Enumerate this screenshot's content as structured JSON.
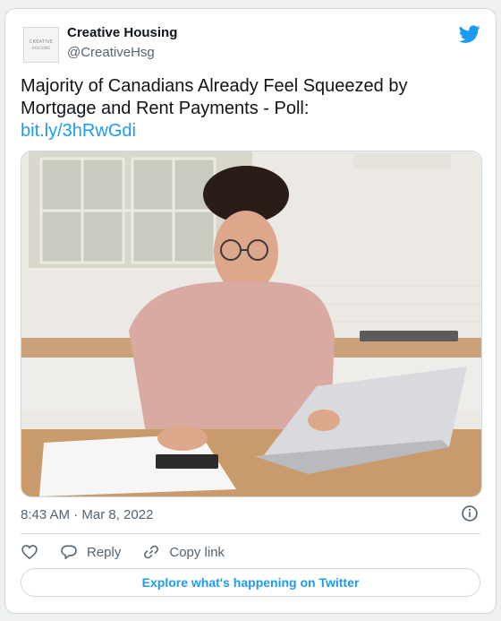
{
  "tweet": {
    "author": {
      "name": "Creative Housing",
      "handle": "@CreativeHsg",
      "avatar_text_line1": "CREATIVE",
      "avatar_text_line2": "HOUSING"
    },
    "text": "Majority of Canadians Already Feel Squeezed by Mortgage and Rent Payments - Poll:",
    "link_text": "bit.ly/3hRwGdi",
    "image": {
      "icon": "photo-woman-with-laptop-and-calculator"
    },
    "timestamp": "8:43 AM · Mar 8, 2022",
    "actions": {
      "like_icon": "heart-icon",
      "reply_label": "Reply",
      "copy_link_label": "Copy link"
    },
    "explore_label": "Explore what's happening on Twitter"
  },
  "colors": {
    "brand": "#1d9bf0",
    "text": "#0f1419",
    "muted": "#536471",
    "border": "#cfd9de"
  }
}
